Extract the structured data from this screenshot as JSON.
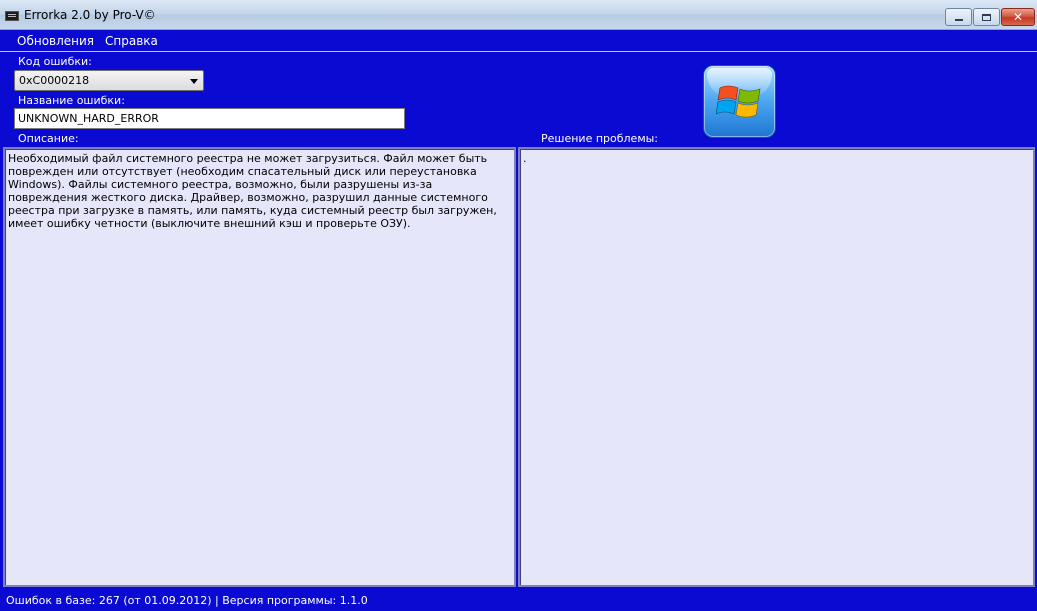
{
  "window": {
    "title": "Errorka 2.0 by Pro-V©",
    "close_symbol": "✕"
  },
  "menu": {
    "items": [
      "Обновления",
      "Справка"
    ]
  },
  "form": {
    "error_code_label": "Код ошибки:",
    "error_code_value": "0xC0000218",
    "error_name_label": "Название ошибки:",
    "error_name_value": "UNKNOWN_HARD_ERROR",
    "description_label": "Описание:",
    "solution_label": "Решение проблемы:",
    "description_text": "Необходимый файл системного реестра не может загрузиться. Файл может быть поврежден или отсутствует (необходим спасательный диск или переустановка Windows). Файлы системного реестра, возможно, были разрушены из-за повреждения жесткого диска. Драйвер, возможно, разрушил данные системного реестра при загрузке в память, или память, куда системный реестр был загружен, имеет ошибку четности (выключите внешний кэш и проверьте ОЗУ).",
    "solution_text": "."
  },
  "status": {
    "text": "Ошибок в базе: 267 (от 01.09.2012) | Версия программы: 1.1.0"
  },
  "icons": {
    "app": "app-console-icon",
    "logo": "windows-logo-icon"
  },
  "colors": {
    "background": "#0a0ad2",
    "panel": "#e6e6fa",
    "text_light": "#ffffff"
  }
}
